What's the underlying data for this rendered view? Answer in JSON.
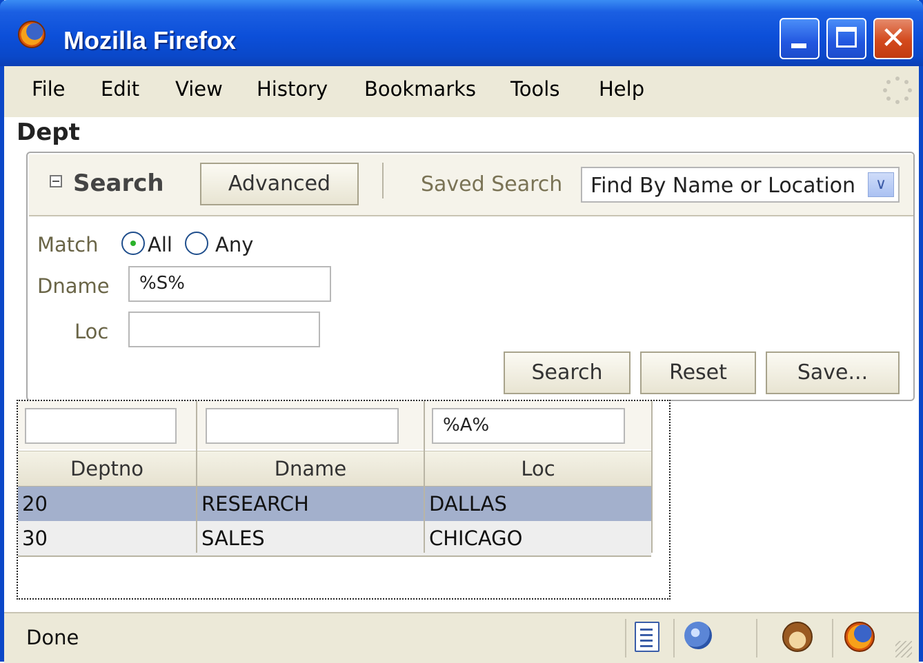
{
  "window": {
    "title": "Mozilla Firefox",
    "controls": {
      "minimize": "minimize",
      "maximize": "maximize",
      "close": "✕"
    }
  },
  "menu": {
    "items": [
      "File",
      "Edit",
      "View",
      "History",
      "Bookmarks",
      "Tools",
      "Help"
    ]
  },
  "page": {
    "heading": "Dept"
  },
  "search": {
    "title": "Search",
    "advanced_label": "Advanced",
    "saved_search_label": "Saved Search",
    "saved_search_selected": "Find By Name or Location",
    "match_label": "Match",
    "match_options": [
      "All",
      "Any"
    ],
    "match_selected": "All",
    "fields": [
      {
        "label": "Dname",
        "value": "%S%"
      },
      {
        "label": "Loc",
        "value": ""
      }
    ],
    "buttons": {
      "search": "Search",
      "reset": "Reset",
      "save": "Save..."
    }
  },
  "results": {
    "filters": [
      "",
      "",
      "%A%"
    ],
    "columns": [
      "Deptno",
      "Dname",
      "Loc"
    ],
    "rows": [
      {
        "deptno": "20",
        "dname": "RESEARCH",
        "loc": "DALLAS",
        "selected": true
      },
      {
        "deptno": "30",
        "dname": "SALES",
        "loc": "CHICAGO",
        "selected": false
      }
    ]
  },
  "status": {
    "text": "Done",
    "icons": [
      "page-icon",
      "network-icon",
      "monkey-icon",
      "firefox-icon"
    ]
  },
  "colors": {
    "titlebar": "#0c4fd9",
    "selected_row": "#a3b0cc",
    "panel_header": "#f5f3ea",
    "chrome": "#ece9d8"
  }
}
